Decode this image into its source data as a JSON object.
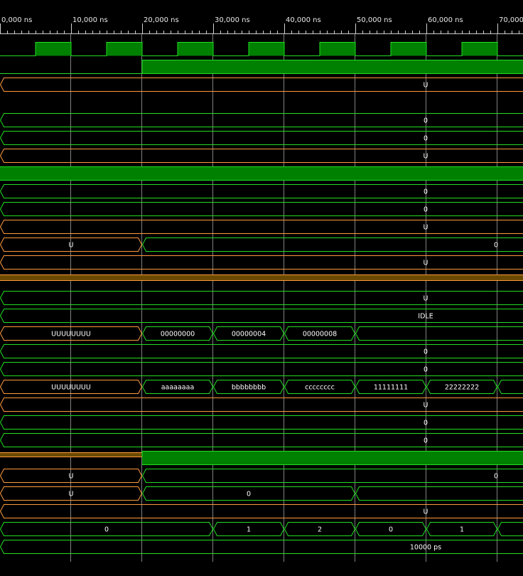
{
  "app": "waveform-viewer",
  "colors": {
    "background": "#000000",
    "grid": "#808080",
    "logic_high_fill": "#008000",
    "logic_edge": "#22dd22",
    "bus_edge": "#22dd22",
    "undefined_edge": "#ff9a3c",
    "undefined_fill": "#6b4a00",
    "text": "#ffffff"
  },
  "timeline": {
    "tick_labels": [
      "0,000 ns",
      "10,000 ns",
      "20,000 ns",
      "30,000 ns",
      "40,000 ns",
      "50,000 ns",
      "60,000 ns",
      "70,000"
    ]
  },
  "signals": [
    {
      "kind": "clock"
    },
    {
      "kind": "step",
      "from": "0",
      "to": "1",
      "at_ns": 20
    },
    {
      "kind": "bus",
      "state": "U",
      "segments": [
        {
          "t0": 0,
          "t1": 74,
          "label": "U"
        }
      ]
    },
    {
      "kind": "blank"
    },
    {
      "kind": "bus",
      "state": "valid",
      "segments": [
        {
          "t0": 0,
          "t1": 74,
          "label": "0"
        }
      ]
    },
    {
      "kind": "bus",
      "state": "valid",
      "segments": [
        {
          "t0": 0,
          "t1": 74,
          "label": "0"
        }
      ]
    },
    {
      "kind": "bus",
      "state": "U",
      "segments": [
        {
          "t0": 0,
          "t1": 74,
          "label": "U"
        }
      ]
    },
    {
      "kind": "high"
    },
    {
      "kind": "bus",
      "state": "valid",
      "segments": [
        {
          "t0": 0,
          "t1": 74,
          "label": "0"
        }
      ]
    },
    {
      "kind": "bus",
      "state": "valid",
      "segments": [
        {
          "t0": 0,
          "t1": 74,
          "label": "0"
        }
      ]
    },
    {
      "kind": "bus",
      "state": "U",
      "segments": [
        {
          "t0": 0,
          "t1": 74,
          "label": "U"
        }
      ]
    },
    {
      "kind": "bus",
      "state": "mixed",
      "segments": [
        {
          "t0": 0,
          "t1": 20,
          "label": "U",
          "u": true
        },
        {
          "t0": 20,
          "t1": 74,
          "label": "0"
        }
      ]
    },
    {
      "kind": "bus",
      "state": "U",
      "segments": [
        {
          "t0": 0,
          "t1": 74,
          "label": "U"
        }
      ]
    },
    {
      "kind": "ubar"
    },
    {
      "kind": "bus",
      "state": "valid",
      "segments": [
        {
          "t0": 0,
          "t1": 74,
          "label": "U"
        }
      ]
    },
    {
      "kind": "bus",
      "state": "valid",
      "segments": [
        {
          "t0": 0,
          "t1": 74,
          "label": "IDLE"
        }
      ]
    },
    {
      "kind": "bus",
      "state": "mixed",
      "segments": [
        {
          "t0": 0,
          "t1": 20,
          "label": "UUUUUUUU",
          "u": true
        },
        {
          "t0": 20,
          "t1": 30,
          "label": "00000000"
        },
        {
          "t0": 30,
          "t1": 40,
          "label": "00000004"
        },
        {
          "t0": 40,
          "t1": 50,
          "label": "00000008"
        },
        {
          "t0": 50,
          "t1": 74,
          "label": ""
        }
      ]
    },
    {
      "kind": "bus",
      "state": "valid",
      "segments": [
        {
          "t0": 0,
          "t1": 74,
          "label": "0"
        }
      ]
    },
    {
      "kind": "bus",
      "state": "valid",
      "segments": [
        {
          "t0": 0,
          "t1": 74,
          "label": "0"
        }
      ]
    },
    {
      "kind": "bus",
      "state": "mixed",
      "segments": [
        {
          "t0": 0,
          "t1": 20,
          "label": "UUUUUUUU",
          "u": true
        },
        {
          "t0": 20,
          "t1": 30,
          "label": "aaaaaaaa"
        },
        {
          "t0": 30,
          "t1": 40,
          "label": "bbbbbbbb"
        },
        {
          "t0": 40,
          "t1": 50,
          "label": "cccccccc"
        },
        {
          "t0": 50,
          "t1": 60,
          "label": "11111111"
        },
        {
          "t0": 60,
          "t1": 70,
          "label": "22222222"
        },
        {
          "t0": 70,
          "t1": 74,
          "label": ""
        }
      ]
    },
    {
      "kind": "bus",
      "state": "U",
      "segments": [
        {
          "t0": 0,
          "t1": 74,
          "label": "U"
        }
      ]
    },
    {
      "kind": "bus",
      "state": "valid",
      "segments": [
        {
          "t0": 0,
          "t1": 74,
          "label": "0"
        }
      ]
    },
    {
      "kind": "bus",
      "state": "valid",
      "segments": [
        {
          "t0": 0,
          "t1": 74,
          "label": "0"
        }
      ]
    },
    {
      "kind": "step_u",
      "to": "1",
      "at_ns": 20
    },
    {
      "kind": "bus",
      "state": "mixed",
      "segments": [
        {
          "t0": 0,
          "t1": 20,
          "label": "U",
          "u": true
        },
        {
          "t0": 20,
          "t1": 74,
          "label": "0"
        }
      ]
    },
    {
      "kind": "bus",
      "state": "mixed",
      "segments": [
        {
          "t0": 0,
          "t1": 20,
          "label": "U",
          "u": true
        },
        {
          "t0": 20,
          "t1": 50,
          "label": "0"
        },
        {
          "t0": 50,
          "t1": 74,
          "label": ""
        }
      ]
    },
    {
      "kind": "bus",
      "state": "U",
      "segments": [
        {
          "t0": 0,
          "t1": 74,
          "label": "U"
        }
      ]
    },
    {
      "kind": "bus",
      "state": "valid",
      "segments": [
        {
          "t0": 0,
          "t1": 30,
          "label": "0"
        },
        {
          "t0": 30,
          "t1": 40,
          "label": "1"
        },
        {
          "t0": 40,
          "t1": 50,
          "label": "2"
        },
        {
          "t0": 50,
          "t1": 60,
          "label": "0"
        },
        {
          "t0": 60,
          "t1": 70,
          "label": "1"
        },
        {
          "t0": 70,
          "t1": 74,
          "label": ""
        }
      ]
    },
    {
      "kind": "bus",
      "state": "valid",
      "segments": [
        {
          "t0": 0,
          "t1": 74,
          "label": "10000 ps"
        }
      ]
    }
  ]
}
